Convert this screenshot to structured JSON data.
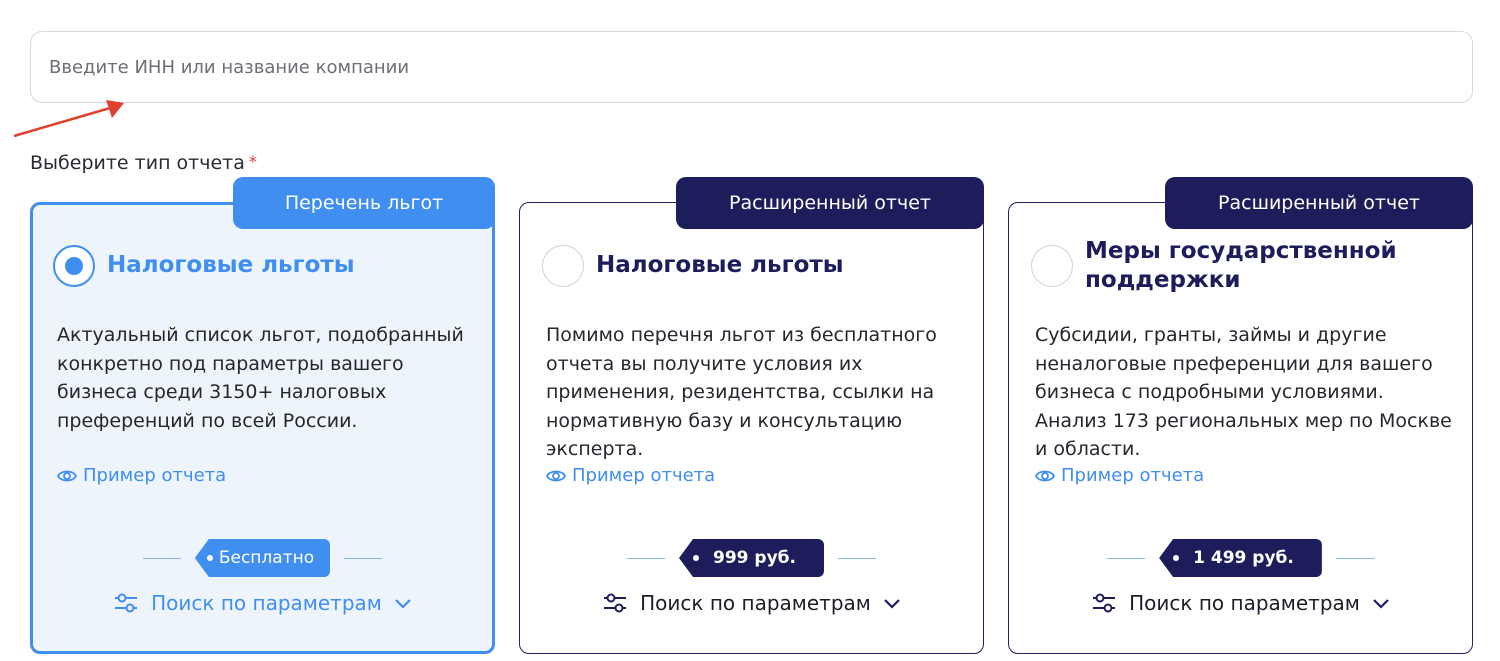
{
  "search": {
    "placeholder": "Введите ИНН или название компании"
  },
  "report_type": {
    "label": "Выберите тип отчета",
    "required_mark": "*"
  },
  "cards": [
    {
      "tag": "Перечень льгот",
      "title": "Налоговые льготы",
      "description": "Актуальный список льгот, подобранный конкретно под параметры вашего бизнеса среди 3150+ налоговых преференций по всей России.",
      "example_link": "Пример отчета",
      "price": "Бесплатно",
      "param_search": "Поиск по параметрам",
      "selected": true
    },
    {
      "tag": "Расширенный отчет",
      "title": "Налоговые льготы",
      "description": "Помимо перечня льгот из бесплатного отчета вы получите условия их применения, резидентства, ссылки на нормативную базу и консультацию эксперта.",
      "example_link": "Пример отчета",
      "price": "999 руб.",
      "param_search": "Поиск по параметрам",
      "selected": false
    },
    {
      "tag": "Расширенный отчет",
      "title": "Меры государственной поддержки",
      "description": "Субсидии, гранты, займы и другие неналоговые преференции для вашего бизнеса с подробными условиями. Анализ 173 региональных мер по Москве и области.",
      "example_link": "Пример отчета",
      "price": "1 499 руб.",
      "param_search": "Поиск по параметрам",
      "selected": false
    }
  ],
  "colors": {
    "accent": "#3f8ef0",
    "dark": "#1d1d5c",
    "annotation_arrow": "#e2402f",
    "required": "#e03a3a"
  },
  "icons": [
    "eye-icon",
    "sliders-icon",
    "chevron-down-icon",
    "arrow-annotation"
  ]
}
